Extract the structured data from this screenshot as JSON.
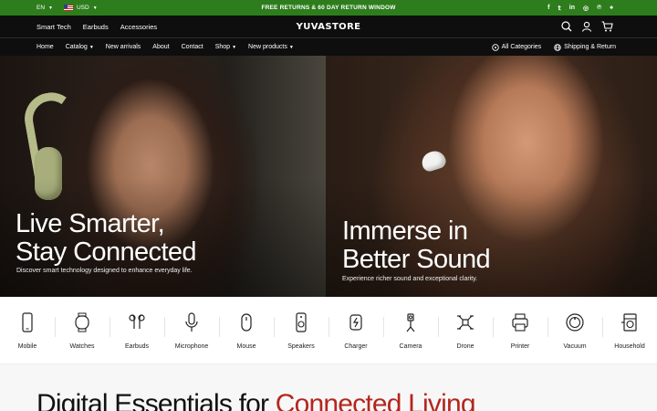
{
  "announcement": {
    "language": "EN",
    "currency": "USD",
    "message": "FREE RETURNS & 60 DAY RETURN WINDOW",
    "social": [
      {
        "icon": "facebook-icon",
        "glyph": "f"
      },
      {
        "icon": "twitter-icon",
        "glyph": "𝕥"
      },
      {
        "icon": "linkedin-icon",
        "glyph": "in"
      },
      {
        "icon": "instagram-icon",
        "glyph": "◎"
      },
      {
        "icon": "pinterest-icon",
        "glyph": "℗"
      },
      {
        "icon": "snapchat-icon",
        "glyph": "♠"
      }
    ],
    "background_color": "#2e7d1d"
  },
  "header": {
    "logo": "YUVASTORE",
    "top_categories": [
      "Smart Tech",
      "Earbuds",
      "Accessories"
    ],
    "nav": [
      {
        "label": "Home",
        "dropdown": false
      },
      {
        "label": "Catalog",
        "dropdown": true
      },
      {
        "label": "New arrivals",
        "dropdown": false
      },
      {
        "label": "About",
        "dropdown": false
      },
      {
        "label": "Contact",
        "dropdown": false
      },
      {
        "label": "Shop",
        "dropdown": true
      },
      {
        "label": "New products",
        "dropdown": true
      }
    ],
    "all_categories": "All Categories",
    "shipping": "Shipping & Return",
    "icons": [
      "search-icon",
      "account-icon",
      "cart-icon"
    ]
  },
  "hero": {
    "left": {
      "title_line1": "Live Smarter,",
      "title_line2": "Stay Connected",
      "subtitle": "Discover smart technology designed to enhance everyday life."
    },
    "right": {
      "title_line1": "Immerse in",
      "title_line2": "Better Sound",
      "subtitle": "Experience richer sound and exceptional clarity."
    }
  },
  "categories": [
    {
      "label": "Mobile",
      "icon": "mobile-icon"
    },
    {
      "label": "Watches",
      "icon": "watch-icon"
    },
    {
      "label": "Earbuds",
      "icon": "earbuds-icon"
    },
    {
      "label": "Microphone",
      "icon": "microphone-icon"
    },
    {
      "label": "Mouse",
      "icon": "mouse-icon"
    },
    {
      "label": "Speakers",
      "icon": "speaker-icon"
    },
    {
      "label": "Charger",
      "icon": "charger-icon"
    },
    {
      "label": "Camera",
      "icon": "camera-icon"
    },
    {
      "label": "Drone",
      "icon": "drone-icon"
    },
    {
      "label": "Printer",
      "icon": "printer-icon"
    },
    {
      "label": "Vacuum",
      "icon": "vacuum-icon"
    },
    {
      "label": "Household",
      "icon": "household-icon"
    }
  ],
  "section": {
    "heading_prefix": "Digital Essentials for ",
    "heading_accent": "Connected Living",
    "accent_color": "#b3261e"
  }
}
